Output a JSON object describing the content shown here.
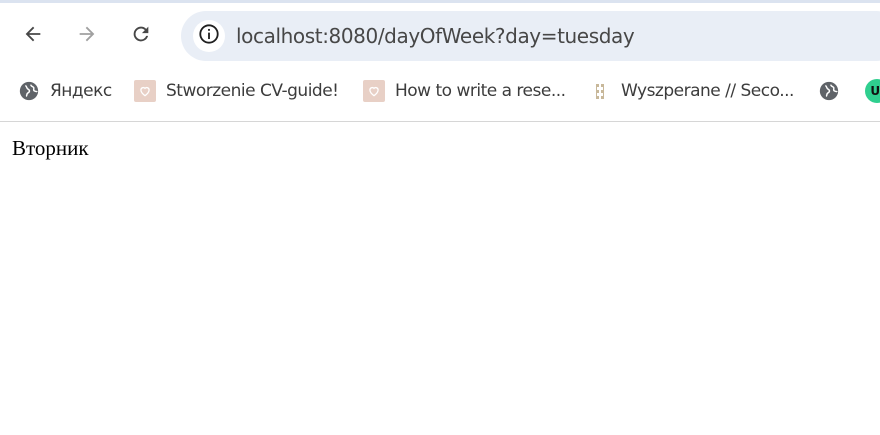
{
  "toolbar": {
    "back_icon": "arrow-left-icon",
    "forward_icon": "arrow-right-icon",
    "reload_icon": "reload-icon"
  },
  "omnibox": {
    "site_info_icon": "info-icon",
    "url_host": "localhost",
    "url_rest": ":8080/dayOfWeek?day=tuesday"
  },
  "bookmarks": [
    {
      "label": "Яндекс",
      "icon": "globe-icon"
    },
    {
      "label": "Stworzenie CV-guide!",
      "icon": "heart-favicon-icon"
    },
    {
      "label": "How to write a rese...",
      "icon": "heart-favicon-icon"
    },
    {
      "label": "Wyszperane // Seco...",
      "icon": "hanger-favicon-icon"
    },
    {
      "label": "",
      "icon": "globe-icon"
    },
    {
      "label": "UI",
      "icon": "green-circle-favicon-icon"
    }
  ],
  "page": {
    "text": "Вторник"
  },
  "colors": {
    "omnibox_bg": "#e9eef6",
    "forward_disabled": "#a0a0a0",
    "icon": "#474747"
  }
}
